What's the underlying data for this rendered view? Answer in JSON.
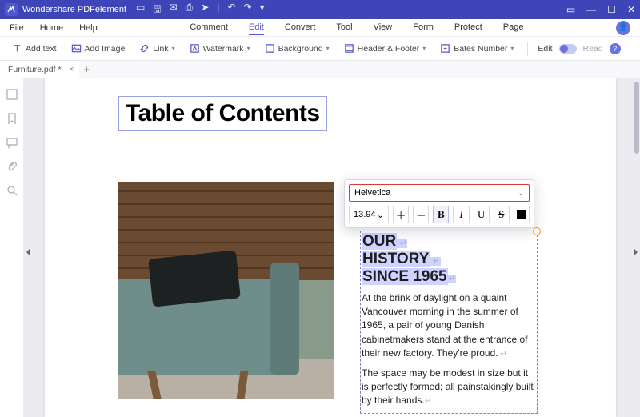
{
  "app": {
    "title": "Wondershare PDFelement"
  },
  "menubar": {
    "left": [
      "File",
      "Home",
      "Help"
    ],
    "center": [
      "Comment",
      "Edit",
      "Convert",
      "Tool",
      "View",
      "Form",
      "Protect",
      "Page"
    ],
    "active": "Edit"
  },
  "toolbar": {
    "add_text": "Add text",
    "add_image": "Add Image",
    "link": "Link",
    "watermark": "Watermark",
    "background": "Background",
    "header_footer": "Header & Footer",
    "bates_number": "Bates Number",
    "edit": "Edit",
    "read": "Read"
  },
  "tab": {
    "name": "Furniture.pdf *"
  },
  "document": {
    "toc_title": "Table of Contents",
    "heading_l1": "OUR",
    "heading_l2": "HISTORY",
    "heading_l3": "SINCE 1965",
    "para1": "At the brink of daylight on a quaint Vancouver morning in the summer of 1965, a pair of young Danish cabinetmakers stand at the entrance of their new factory. They're proud.",
    "para2": "The space may be modest in size but it is perfectly formed; all painstakingly built by their hands."
  },
  "format_popup": {
    "font": "Helvetica",
    "size": "13.94"
  }
}
